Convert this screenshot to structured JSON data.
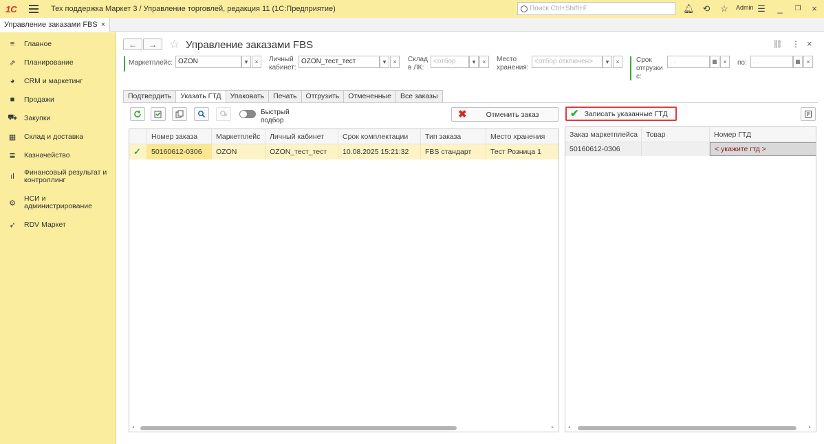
{
  "titlebar": {
    "logo": "1С",
    "app_title": "Тех поддержка Маркет 3 / Управление торговлей, редакция 11  (1С:Предприятие)",
    "search_placeholder": "Поиск Ctrl+Shift+F",
    "user": "Admin"
  },
  "open_tab": {
    "label": "Управление заказами FBS",
    "close": "×"
  },
  "sidebar": {
    "items": [
      {
        "label": "Главное",
        "icon": "menu-icon"
      },
      {
        "label": "Планирование",
        "icon": "chart-growth-icon"
      },
      {
        "label": "CRM и маркетинг",
        "icon": "pie-chart-icon"
      },
      {
        "label": "Продажи",
        "icon": "shopping-bag-icon"
      },
      {
        "label": "Закупки",
        "icon": "cart-icon"
      },
      {
        "label": "Склад и доставка",
        "icon": "warehouse-icon"
      },
      {
        "label": "Казначейство",
        "icon": "coins-icon"
      },
      {
        "label": "Финансовый результат и контроллинг",
        "icon": "bar-chart-icon"
      },
      {
        "label": "НСИ и администрирование",
        "icon": "gear-icon"
      },
      {
        "label": "RDV Маркет",
        "icon": "rocket-icon"
      }
    ]
  },
  "page": {
    "title": "Управление заказами FBS",
    "back": "←",
    "forward": "→",
    "star": "☆",
    "link": "🔗",
    "more": "⋮",
    "close": "×"
  },
  "filters": {
    "marketplace_label": "Маркетплейс:",
    "marketplace_value": "OZON",
    "cabinet_label_1": "Личный",
    "cabinet_label_2": "кабинет:",
    "cabinet_value": "OZON_тест_тест",
    "warehouse_label_1": "Склад",
    "warehouse_label_2": "в ЛК:",
    "warehouse_placeholder": "<отбор",
    "storage_label_1": "Место",
    "storage_label_2": "хранения:",
    "storage_placeholder": "<отбор отключен>",
    "ship_label_1": "Срок",
    "ship_label_2": "отгрузки",
    "ship_label_3": "с:",
    "date_from": " .  .",
    "to_label": "по:",
    "date_to": " .  .",
    "dropdown_glyph": "▾",
    "clear_glyph": "×"
  },
  "tabs": [
    "Подтвердить",
    "Указать ГТД",
    "Упаковать",
    "Печать",
    "Отгрузить",
    "Отмененные",
    "Все заказы"
  ],
  "left_panel": {
    "quick_select_1": "Быстрый",
    "quick_select_2": "подбор",
    "cancel_order": "Отменить заказ",
    "columns": [
      "Номер заказа",
      "Маркетплейс",
      "Личный кабинет",
      "Срок комплектации",
      "Тип заказа",
      "Место хранения"
    ],
    "rows": [
      {
        "check": "✓",
        "number": "50160612-0306",
        "marketplace": "OZON",
        "cabinet": "OZON_тест_тест",
        "deadline": "10.08.2025 15:21:32",
        "type": "FBS стандарт",
        "storage": "Тест Розница 1"
      }
    ]
  },
  "right_panel": {
    "save_gtd": "Записать указанные ГТД",
    "columns": [
      "Заказ маркетплейса",
      "Товар",
      "Номер ГТД"
    ],
    "rows": [
      {
        "order": "50160612-0306",
        "product": "",
        "gtd": "< укажите гтд >"
      }
    ]
  },
  "colors": {
    "sidebar_bg": "#fbed9e",
    "accent_green": "#3aa935",
    "highlight_row": "#fdf3c6",
    "danger_red": "#d52b1e"
  }
}
